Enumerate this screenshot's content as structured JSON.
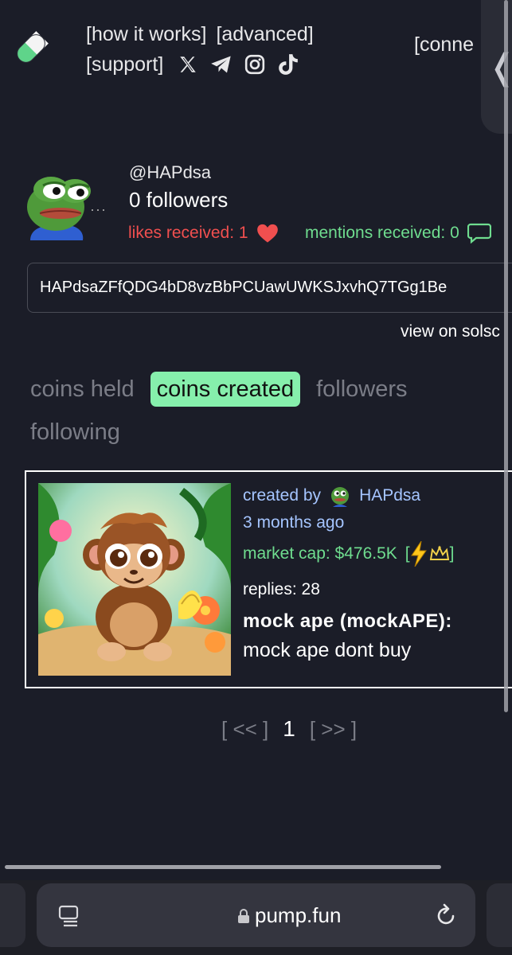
{
  "nav": {
    "how_it_works": "[how it works]",
    "advanced": "[advanced]",
    "support": "[support]",
    "connect": "[conne"
  },
  "side_tab": {
    "glyph": "❬"
  },
  "profile": {
    "handle": "@HAPdsa",
    "followers": "0 followers",
    "likes": "likes received: 1",
    "mentions": "mentions received: 0",
    "address": "HAPdsaZFfQDG4bD8vzBbPCUawUWKSJxvhQ7TGg1Be",
    "view_on": "view on solsc",
    "more_dots": "···"
  },
  "tabs": {
    "coins_held": "coins held",
    "coins_created": "coins created",
    "followers": "followers",
    "following": "following"
  },
  "coin": {
    "created_by_label": "created by",
    "creator": "HAPdsa",
    "age": "3 months ago",
    "market_cap": "market cap: $476.5K",
    "replies": "replies: 28",
    "name": "mock ape (mockAPE):",
    "description": "mock ape dont buy",
    "bracket_open": "[",
    "bracket_close": "]"
  },
  "pager": {
    "prev": "[ << ]",
    "current": "1",
    "next": "[ >> ]"
  },
  "browser": {
    "url": "pump.fun"
  },
  "colors": {
    "background": "#1b1d28",
    "likes": "#f04f4f",
    "mentions": "#6fdd8f",
    "active_tab": "#86efac",
    "link_blue": "#a5c5ff"
  },
  "icons": [
    "pill-logo-icon",
    "x-icon",
    "telegram-icon",
    "instagram-icon",
    "tiktok-icon",
    "heart-icon",
    "chat-bubble-icon",
    "lightning-icon",
    "crown-icon",
    "reader-icon",
    "lock-icon",
    "reload-icon"
  ]
}
